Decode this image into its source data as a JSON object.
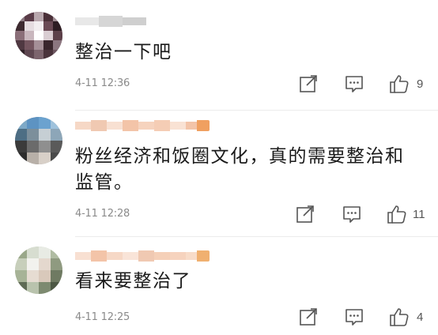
{
  "comments": [
    {
      "username": "",
      "content": "整治一下吧",
      "time": "4-11 12:36",
      "likes": "9",
      "icons": {
        "avatar": "blurred-avatar",
        "repost": "repost-icon",
        "reply": "comment-icon",
        "like": "thumbs-up-icon"
      }
    },
    {
      "username": "",
      "content": "粉丝经济和饭圈文化，真的需要整治和监管。",
      "time": "4-11 12:28",
      "likes": "11",
      "icons": {
        "avatar": "blurred-avatar",
        "repost": "repost-icon",
        "reply": "comment-icon",
        "like": "thumbs-up-icon"
      }
    },
    {
      "username": "",
      "content": "看来要整治了",
      "time": "4-11 12:25",
      "likes": "4",
      "icons": {
        "avatar": "blurred-avatar",
        "repost": "repost-icon",
        "reply": "comment-icon",
        "like": "thumbs-up-icon"
      }
    }
  ],
  "colors": {
    "text": "#1a1a1a",
    "meta": "#8a8a8a",
    "icon": "#555555",
    "divider": "#ececec",
    "username_highlight": "#f3c4a8"
  }
}
